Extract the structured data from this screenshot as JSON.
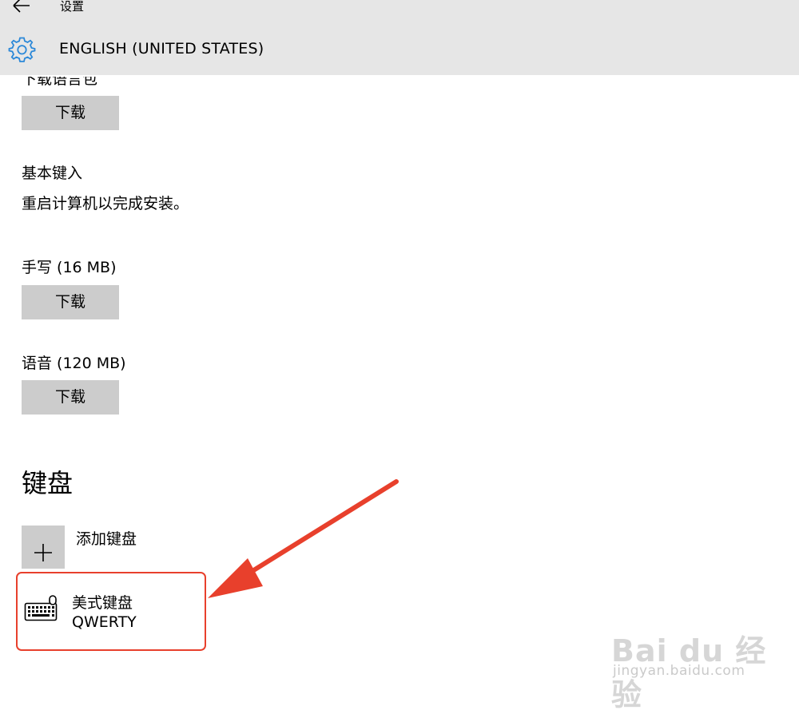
{
  "header": {
    "title": "设置",
    "page_title": "ENGLISH (UNITED STATES)"
  },
  "sections": {
    "language_pack": {
      "label": "下载语言包",
      "button_label": "下载"
    },
    "basic_typing": {
      "label": "基本键入",
      "status": "重启计算机以完成安装。"
    },
    "handwriting": {
      "label": "手写 (16 MB)",
      "button_label": "下载"
    },
    "speech": {
      "label": "语音 (120 MB)",
      "button_label": "下载"
    }
  },
  "keyboards": {
    "heading": "键盘",
    "add_label": "添加键盘",
    "items": [
      {
        "name": "美式键盘",
        "layout": "QWERTY"
      }
    ]
  },
  "watermark": {
    "brand": "Bai du 经验",
    "url": "jingyan.baidu.com"
  },
  "colors": {
    "header_bg": "#e6e6e6",
    "button_bg": "#cccccc",
    "accent": "#2b88d8",
    "annotation": "#e8402c"
  },
  "icons": {
    "back": "back-arrow-icon",
    "settings": "gear-icon",
    "add": "plus-icon",
    "keyboard": "keyboard-icon"
  }
}
